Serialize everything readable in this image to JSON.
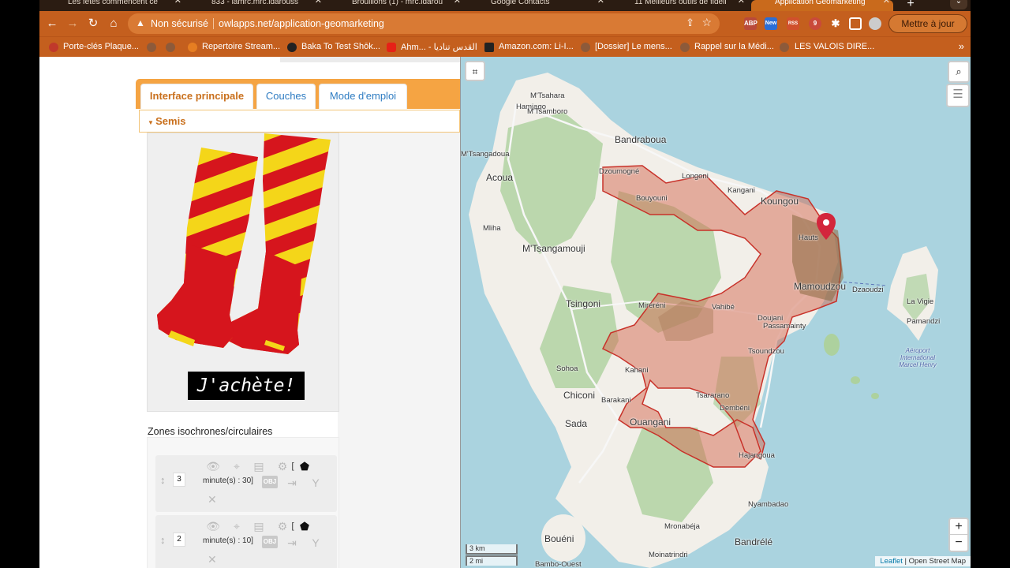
{
  "browser": {
    "tabs": [
      {
        "title": "Les fêtes commencent ce"
      },
      {
        "title": "833 - lamrc.mrc.idarouss"
      },
      {
        "title": "Brouillons (1) - mrc.idarou"
      },
      {
        "title": "Google Contacts"
      },
      {
        "title": "11 Meilleurs outils de fidéli"
      },
      {
        "title": "Application Geomarketing",
        "active": true
      }
    ],
    "security_label": "Non sécurisé",
    "url": "owlapps.net/application-geomarketing",
    "update_button": "Mettre à jour",
    "extensions": [
      {
        "name": "abp-icon",
        "label": "ABP",
        "color": "#b94a3a"
      },
      {
        "name": "new-extension-icon",
        "label": "New",
        "color": "#2c6ed5"
      },
      {
        "name": "rss-icon",
        "label": "RSS",
        "color": "#d0502c"
      },
      {
        "name": "pin-extension-icon",
        "label": "9",
        "color": "#c94a3a"
      },
      {
        "name": "puzzle-icon",
        "label": "",
        "color": "#c45f1e"
      },
      {
        "name": "sidebar-icon",
        "label": "",
        "color": "#c45f1e"
      },
      {
        "name": "profile-avatar",
        "label": "",
        "color": "#cccccc"
      }
    ],
    "bookmarks": [
      {
        "label": "Porte-clés Plaque..."
      },
      {
        "label": "Repertoire Stream..."
      },
      {
        "label": "Baka To Test Shōk..."
      },
      {
        "label": "Ahm... - القدس تناديا"
      },
      {
        "label": "Amazon.com: Li-I..."
      },
      {
        "label": "[Dossier] Le mens..."
      },
      {
        "label": "Rappel sur la Médi..."
      },
      {
        "label": "LES VALOIS DIRE..."
      }
    ]
  },
  "app": {
    "tabs": [
      {
        "label": "Interface principale",
        "active": true
      },
      {
        "label": "Couches"
      },
      {
        "label": "Mode d'emploi"
      }
    ],
    "accordion_title": "Semis",
    "ad": {
      "cta": "J'achète!"
    },
    "zones": {
      "title": "Zones isochrones/circulaires",
      "rows": [
        {
          "index": "3",
          "text": "minute(s) : 30]",
          "obj": "OBJ",
          "bracket": "["
        },
        {
          "index": "2",
          "text": "minute(s) : 10]",
          "obj": "OBJ",
          "bracket": "["
        }
      ]
    }
  },
  "map": {
    "labels": [
      {
        "text": "M'Tsahara"
      },
      {
        "text": "Hamjago"
      },
      {
        "text": "M'Tsamboro"
      },
      {
        "text": "M'Tsangadoua"
      },
      {
        "text": "Bandraboua"
      },
      {
        "text": "Acoua"
      },
      {
        "text": "Dzoumogné"
      },
      {
        "text": "Bouyouni"
      },
      {
        "text": "Longoni"
      },
      {
        "text": "Kangani"
      },
      {
        "text": "Koungou"
      },
      {
        "text": "Mliha"
      },
      {
        "text": "M'Tsangamouji"
      },
      {
        "text": "Hauts"
      },
      {
        "text": "Mamoudzou"
      },
      {
        "text": "Dzaoudzi"
      },
      {
        "text": "La Vigie"
      },
      {
        "text": "Pamandzi"
      },
      {
        "text": "Tsingoni"
      },
      {
        "text": "Miréréni"
      },
      {
        "text": "Vahibé"
      },
      {
        "text": "Doujani"
      },
      {
        "text": "Passamainty"
      },
      {
        "text": "Tsoundzou"
      },
      {
        "text": "Sohoa"
      },
      {
        "text": "Kahani"
      },
      {
        "text": "Chiconi"
      },
      {
        "text": "Barakani"
      },
      {
        "text": "Tsararano"
      },
      {
        "text": "Dembéni"
      },
      {
        "text": "Sada"
      },
      {
        "text": "Ouangani"
      },
      {
        "text": "Hajangoua"
      },
      {
        "text": "Nyambadao"
      },
      {
        "text": "Bouéni"
      },
      {
        "text": "Bandrélé"
      },
      {
        "text": "Bambo-Ouest"
      },
      {
        "text": "Mronabéja"
      },
      {
        "text": "Moinatrindri"
      }
    ],
    "airport_label": "Aéroport International Marcel Henry",
    "scale": {
      "metric": "3 km",
      "imperial": "2 mi"
    },
    "attribution": {
      "lib": "Leaflet",
      "sep": " | ",
      "source": "Open Street Map"
    },
    "zoom": {
      "in": "+",
      "out": "−"
    },
    "colors": {
      "sea": "#aad3df",
      "land": "#f2efe9",
      "forest": "#add19e",
      "isochrone_fill": "#d46a52",
      "isochrone_stroke": "#c8322a",
      "marker": "#d3263c"
    }
  }
}
